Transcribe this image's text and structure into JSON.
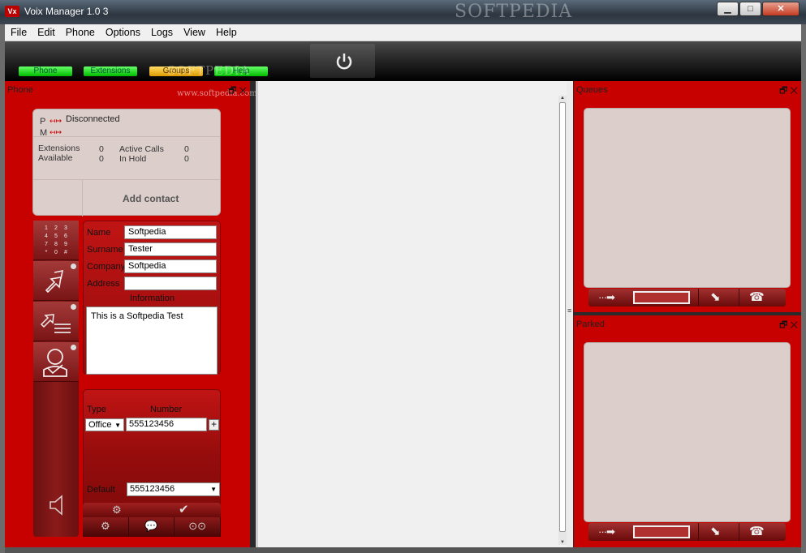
{
  "window": {
    "title": "Voix Manager 1.0 3",
    "app_icon": "Vx",
    "watermark": "SOFTPEDIA",
    "min_label": "▁",
    "max_label": "□",
    "close_label": "✕"
  },
  "menu": [
    "File",
    "Edit",
    "Phone",
    "Options",
    "Logs",
    "View",
    "Help"
  ],
  "toolbar": {
    "nav": [
      {
        "label": "Phone",
        "color": "green"
      },
      {
        "label": "Extensions",
        "color": "green"
      },
      {
        "label": "Groups",
        "color": "orange"
      },
      {
        "label": "Help",
        "color": "green"
      }
    ],
    "watermark": "SOFTPEDIA"
  },
  "phone_panel": {
    "title": "Phone",
    "watermark": "www.softpedia.com",
    "ctrl_restore": "🗗",
    "ctrl_close": "✕",
    "status": {
      "p": "P",
      "m": "M",
      "p_arrows": "↤↦",
      "m_arrows": "↤↦",
      "state": "Disconnected"
    },
    "stats": {
      "extensions_label": "Extensions",
      "extensions_value": "0",
      "available_label": "Available",
      "available_value": "0",
      "active_calls_label": "Active Calls",
      "active_calls_value": "0",
      "in_hold_label": "In Hold",
      "in_hold_value": "0"
    },
    "add_contact": "Add contact",
    "keypad": [
      "1",
      "2",
      "3",
      "4",
      "5",
      "6",
      "7",
      "8",
      "9",
      "*",
      "0",
      "#"
    ]
  },
  "contact": {
    "name_label": "Name",
    "name_value": "Softpedia",
    "surname_label": "Surname",
    "surname_value": "Tester",
    "company_label": "Company",
    "company_value": "Softpedia",
    "address_label": "Address",
    "address_value": "",
    "information_label": "Information",
    "information_value": "This is a Softpedia Test"
  },
  "numbers": {
    "type_label": "Type",
    "number_label": "Number",
    "type_value": "Office",
    "number_value": "555123456",
    "add_label": "+",
    "default_label": "Default",
    "default_value": "555123456"
  },
  "queues_panel": {
    "title": "Queues"
  },
  "parked_panel": {
    "title": "Parked"
  },
  "colors": {
    "panel_red": "#c70000",
    "pane_beige": "#dccfcb",
    "nav_green": "#00bb00",
    "nav_orange": "#dd9900"
  }
}
